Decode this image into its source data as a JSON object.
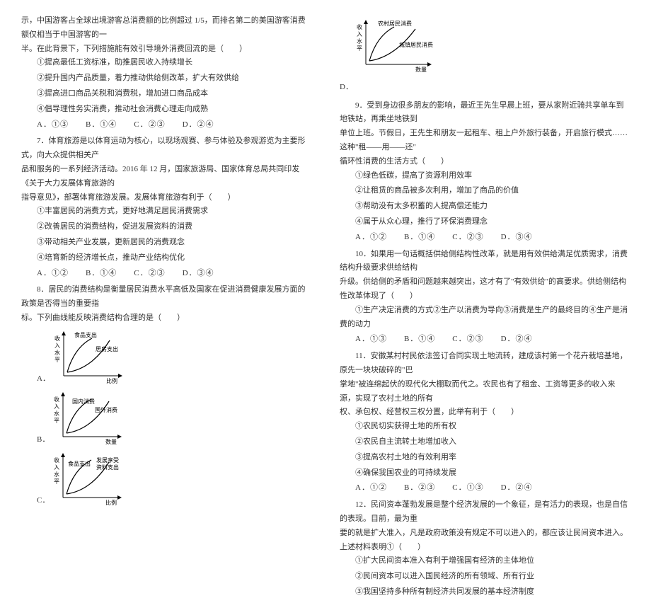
{
  "left_column": {
    "q6_intro_line1": "示，中国游客占全球出境游客总消费额的比例超过 1/5，而排名第二的美国游客消费额仅相当于中国游客的一",
    "q6_intro_line2": "半。在此背景下，下列措施能有效引导境外消费回流的是（　　）",
    "q6_opt1": "①提高最低工资标准，助推居民收入持续增长",
    "q6_opt2": "②提升国内产品质量，着力推动供给侧改革，扩大有效供给",
    "q6_opt3": "③提高进口商品关税和消费税，增加进口商品成本",
    "q6_opt4": "④倡导理性务实消费，推动社会消费心理走向成熟",
    "q6_choices": "A．①③　　B．①④　　C．②③　　D．②④",
    "q7_line1": "7．体育旅游是以体育运动为核心，以现场观赛、参与体验及参观游览为主要形式，向大众提供相关产",
    "q7_line2": "品和服务的一系列经济活动。2016 年 12 月，国家旅游局、国家体育总局共同印发《关于大力发展体育旅游的",
    "q7_line3": "指导意见》，部署体育旅游发展。发展体育旅游有利于（　　）",
    "q7_opt1": "①丰富居民的消费方式，更好地满足居民消费需求",
    "q7_opt2": "②改善居民的消费结构，促进发展资料的消费",
    "q7_opt3": "③带动相关产业发展，更新居民的消费观念",
    "q7_opt4": "④培育新的经济增长点，推动产业结构优化",
    "q7_choices": "A．①②　　B．①④　　C．②③　　D．③④",
    "q8_line1": "8．居民的消费结构是衡量居民消费水平高低及国家在促进消费健康发展方面的政策是否得当的重要指",
    "q8_line2": "标。下列曲线能反映消费结构合理的是（　　）",
    "chart_a_label": "A．",
    "chart_a_ylabel": "收入水平",
    "chart_a_curve1": "食品支出",
    "chart_a_curve2": "居房支出",
    "chart_a_xlabel": "比例",
    "chart_b_label": "B．",
    "chart_b_ylabel": "收入水平",
    "chart_b_curve1": "国内消费",
    "chart_b_curve2": "国外消费",
    "chart_b_xlabel": "数量",
    "chart_c_label": "C．",
    "chart_c_ylabel": "收入水平",
    "chart_c_curve1": "食品支出",
    "chart_c_curve2": "发展享受资料支出",
    "chart_c_xlabel": "比例"
  },
  "right_column": {
    "chart_d_label": "D．",
    "chart_d_ylabel": "收入水平",
    "chart_d_curve1": "农村居民消费",
    "chart_d_curve2": "城镇居民消费",
    "chart_d_xlabel": "数量",
    "q9_line1": "9．受到身边很多朋友的影响，最近王先生早晨上班，要从家附近骑共享单车到地铁站，再乘坐地铁到",
    "q9_line2": "单位上班。节假日，王先生和朋友一起租车、租上户外旅行装备，开启旅行模式……这种\"租——用——还\"",
    "q9_line3": "循环性消费的生活方式（　　）",
    "q9_opt1": "①绿色低碳，提高了资源利用效率",
    "q9_opt2": "②让租赁的商品被多次利用，增加了商品的价值",
    "q9_opt3": "③帮助没有太多积蓄的人提高偿还能力",
    "q9_opt4": "④属于从众心理，推行了环保消费理念",
    "q9_choices": "A．①②　　B．①④　　C．②③　　D．③④",
    "q10_line1": "10．如果用一句话概括供给侧结构性改革，就是用有效供给满足优质需求，消费结构升级要求供给结构",
    "q10_line2": "升级。供给侧的矛盾和问题越来越突出，这才有了\"有效供给\"的高要求。供给侧结构性改革体现了（　　）",
    "q10_opt1": "①生产决定消费的方式②生产以消费为导向③消费是生产的最终目的④生产是消费的动力",
    "q10_choices": "A．①③　　B．①④　　C．②③　　D．②④",
    "q11_line1": "11．安徽某村村民依法签订合同实现土地流转，建成该村第一个花卉栽培基地，原先一块块破碎的\"巴",
    "q11_line2": "掌地\"被连绵起伏的现代化大棚取而代之。农民也有了租金、工资等更多的收入来源，实现了农村土地的所有",
    "q11_line3": "权、承包权、经营权三权分置，此举有利于（　　）",
    "q11_opt1": "①农民切实获得土地的所有权",
    "q11_opt2": "②农民自主流转土地增加收入",
    "q11_opt3": "③提高农村土地的有效利用率",
    "q11_opt4": "④确保我国农业的可持续发展",
    "q11_choices": "A．①②　　B．②③　　C．①③　　D．②④",
    "q12_line1": "12．民间资本蓬勃发展是整个经济发展的一个象征，是有活力的表现，也是自信的表现。目前，最为重",
    "q12_line2": "要的就是扩大准入，凡是政府政策没有规定不可以进入的，都应该让民间资本进入。上述材料表明①（　　）",
    "q12_opt1": "①扩大民间资本准入有利于增强国有经济的主体地位",
    "q12_opt2": "②民间资本可以进入国民经济的所有领域、所有行业",
    "q12_opt3": "③我国坚持多种所有制经济共同发展的基本经济制度"
  },
  "chart_data": [
    {
      "type": "line",
      "label": "A",
      "ylabel": "收入水平",
      "xlabel": "比例",
      "series": [
        {
          "name": "食品支出",
          "shape": "convex_up"
        },
        {
          "name": "居房支出",
          "shape": "concave_down"
        }
      ]
    },
    {
      "type": "line",
      "label": "B",
      "ylabel": "收入水平",
      "xlabel": "数量",
      "series": [
        {
          "name": "国内消费",
          "shape": "convex_up"
        },
        {
          "name": "国外消费",
          "shape": "concave_down"
        }
      ]
    },
    {
      "type": "line",
      "label": "C",
      "ylabel": "收入水平",
      "xlabel": "比例",
      "series": [
        {
          "name": "食品支出",
          "shape": "concave_down"
        },
        {
          "name": "发展享受资料支出",
          "shape": "convex_up"
        }
      ]
    },
    {
      "type": "line",
      "label": "D",
      "ylabel": "收入水平",
      "xlabel": "数量",
      "series": [
        {
          "name": "农村居民消费",
          "shape": "convex_up"
        },
        {
          "name": "城镇居民消费",
          "shape": "concave_down"
        }
      ]
    }
  ]
}
